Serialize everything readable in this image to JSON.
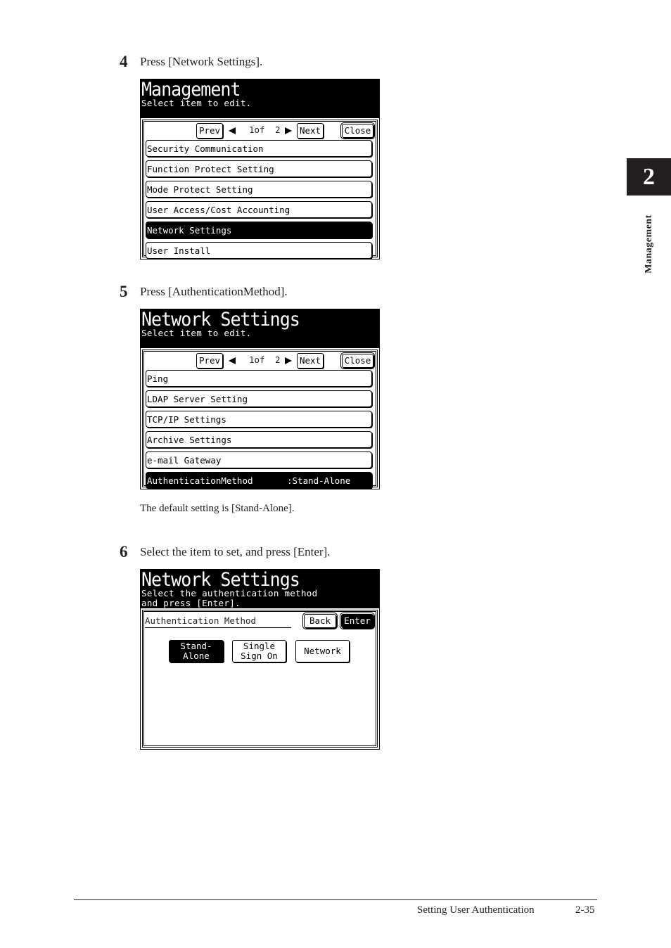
{
  "side_tab": {
    "chapter": "2",
    "label": "Management"
  },
  "steps": [
    {
      "number": "4",
      "text": "Press [Network Settings].",
      "screen": {
        "title": "Management",
        "subtitle": "Select item to edit.",
        "pager": {
          "prev": "Prev",
          "page": "1of",
          "total": "2",
          "next": "Next",
          "close": "Close"
        },
        "items": [
          {
            "label": "Security Communication",
            "selected": false
          },
          {
            "label": "Function Protect Setting",
            "selected": false
          },
          {
            "label": "Mode Protect Setting",
            "selected": false
          },
          {
            "label": "User Access/Cost Accounting",
            "selected": false
          },
          {
            "label": "Network Settings",
            "selected": true
          },
          {
            "label": "User Install",
            "selected": false
          }
        ]
      }
    },
    {
      "number": "5",
      "text": "Press [AuthenticationMethod].",
      "note": "The default setting is [Stand-Alone].",
      "screen": {
        "title": "Network Settings",
        "subtitle": "Select item to edit.",
        "pager": {
          "prev": "Prev",
          "page": "1of",
          "total": "2",
          "next": "Next",
          "close": "Close"
        },
        "items": [
          {
            "label": "Ping",
            "selected": false
          },
          {
            "label": "LDAP Server Setting",
            "selected": false
          },
          {
            "label": "TCP/IP Settings",
            "selected": false
          },
          {
            "label": "Archive Settings",
            "selected": false
          },
          {
            "label": "e-mail Gateway",
            "selected": false
          },
          {
            "label": "AuthenticationMethod",
            "value": ":Stand-Alone",
            "selected": true
          }
        ]
      }
    },
    {
      "number": "6",
      "text": "Select the item to set, and press [Enter].",
      "screen": {
        "title": "Network Settings",
        "subtitle_line1": "Select the authentication method",
        "subtitle_line2": "and press [Enter].",
        "field_label": "Authentication Method",
        "back": "Back",
        "enter": "Enter",
        "options": [
          {
            "label": "Stand-\nAlone",
            "selected": true
          },
          {
            "label": "Single\nSign On",
            "selected": false
          },
          {
            "label": "Network",
            "selected": false
          }
        ]
      }
    }
  ],
  "footer": {
    "section": "Setting User Authentication",
    "page": "2-35"
  }
}
